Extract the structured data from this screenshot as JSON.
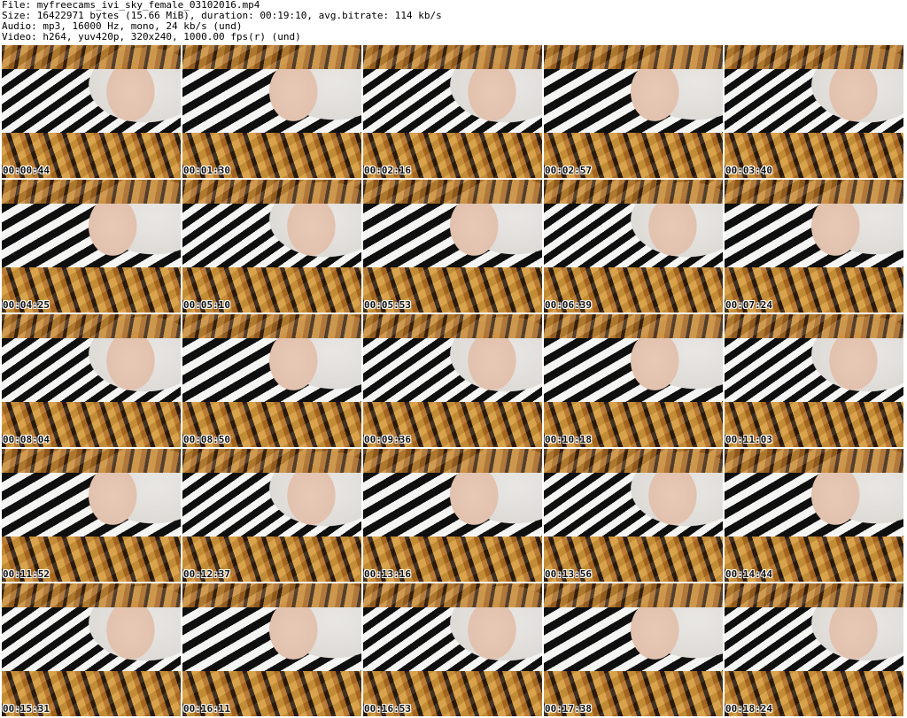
{
  "info": {
    "file": "File: myfreecams_ivi_sky_female_03102016.mp4",
    "size": "Size: 16422971 bytes (15.66 MiB), duration: 00:19:10, avg.bitrate: 114 kb/s",
    "audio": "Audio: mp3, 16000 Hz, mono, 24 kb/s (und)",
    "video": "Video: h264, yuv420p, 320x240, 1000.00 fps(r) (und)"
  },
  "timestamps": [
    "00:00:44",
    "00:01:30",
    "00:02:16",
    "00:02:57",
    "00:03:40",
    "00:04:25",
    "00:05:10",
    "00:05:53",
    "00:06:39",
    "00:07:24",
    "00:08:04",
    "00:08:50",
    "00:09:36",
    "00:10:18",
    "00:11:03",
    "00:11:52",
    "00:12:37",
    "00:13:16",
    "00:13:56",
    "00:14:44",
    "00:15:31",
    "00:16:11",
    "00:16:53",
    "00:17:38",
    "00:18:24"
  ]
}
